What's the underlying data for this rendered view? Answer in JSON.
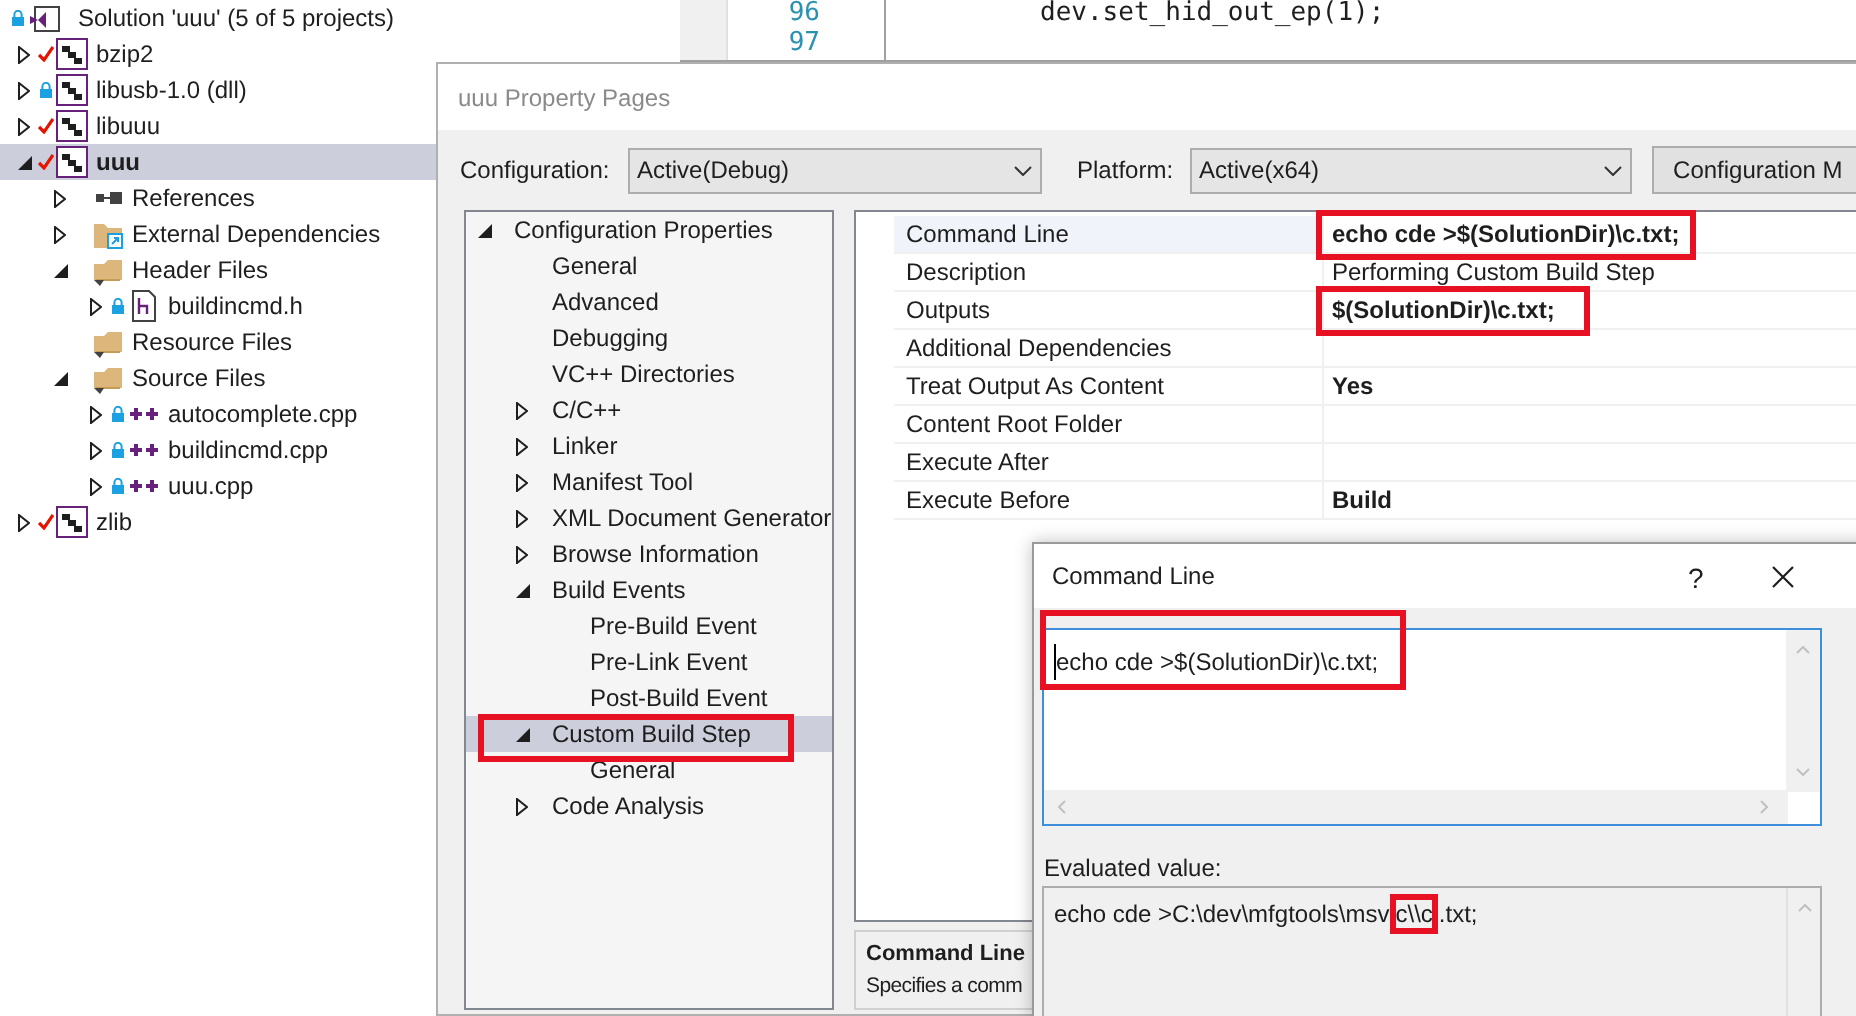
{
  "solution_explorer": {
    "solution": {
      "label": "Solution 'uuu' (5 of 5 projects)",
      "locked": true,
      "checked_out": false
    },
    "items": [
      {
        "label": "bzip2",
        "kind": "project",
        "checked_out": true,
        "locked": false,
        "expanded": false,
        "selected": false
      },
      {
        "label": "libusb-1.0 (dll)",
        "kind": "project",
        "checked_out": false,
        "locked": true,
        "expanded": false,
        "selected": false
      },
      {
        "label": "libuuu",
        "kind": "project",
        "checked_out": true,
        "locked": false,
        "expanded": false,
        "selected": false
      },
      {
        "label": "uuu",
        "kind": "project",
        "checked_out": true,
        "locked": false,
        "expanded": true,
        "selected": true,
        "children": [
          {
            "label": "References",
            "kind": "references",
            "expanded": false,
            "selected": false
          },
          {
            "label": "External Dependencies",
            "kind": "external",
            "expanded": false,
            "selected": false
          },
          {
            "label": "Header Files",
            "kind": "filter",
            "expanded": true,
            "selected": false,
            "children": [
              {
                "label": "buildincmd.h",
                "kind": "header",
                "checked_out": false,
                "locked": true,
                "expanded": false,
                "selected": false
              }
            ]
          },
          {
            "label": "Resource Files",
            "kind": "filter",
            "selected": false
          },
          {
            "label": "Source Files",
            "kind": "filter",
            "expanded": true,
            "selected": false,
            "children": [
              {
                "label": "autocomplete.cpp",
                "kind": "cpp",
                "checked_out": false,
                "locked": true,
                "expanded": false,
                "selected": false
              },
              {
                "label": "buildincmd.cpp",
                "kind": "cpp",
                "checked_out": false,
                "locked": true,
                "expanded": false,
                "selected": false
              },
              {
                "label": "uuu.cpp",
                "kind": "cpp",
                "checked_out": false,
                "locked": true,
                "expanded": false,
                "selected": false
              }
            ]
          }
        ]
      },
      {
        "label": "zlib",
        "kind": "project",
        "checked_out": true,
        "locked": false,
        "expanded": false,
        "selected": false
      }
    ]
  },
  "editor": {
    "lines": [
      {
        "number": "96",
        "code": "dev.set_hid_out_ep(1);"
      },
      {
        "number": "97"
      }
    ]
  },
  "property_pages": {
    "title": "uuu Property Pages",
    "configuration_label": "Configuration:",
    "configuration_value": "Active(Debug)",
    "platform_label": "Platform:",
    "platform_value": "Active(x64)",
    "manager_button": "Configuration M",
    "tree": [
      {
        "label": "Configuration Properties",
        "expanded": true,
        "selected": false,
        "children": [
          {
            "label": "General",
            "selected": false
          },
          {
            "label": "Advanced",
            "selected": false
          },
          {
            "label": "Debugging",
            "selected": false
          },
          {
            "label": "VC++ Directories",
            "selected": false
          },
          {
            "label": "C/C++",
            "expanded": false,
            "selected": false
          },
          {
            "label": "Linker",
            "expanded": false,
            "selected": false
          },
          {
            "label": "Manifest Tool",
            "expanded": false,
            "selected": false
          },
          {
            "label": "XML Document Generator",
            "expanded": false,
            "selected": false
          },
          {
            "label": "Browse Information",
            "expanded": false,
            "selected": false
          },
          {
            "label": "Build Events",
            "expanded": true,
            "selected": false,
            "children": [
              {
                "label": "Pre-Build Event",
                "selected": false
              },
              {
                "label": "Pre-Link Event",
                "selected": false
              },
              {
                "label": "Post-Build Event",
                "selected": false
              }
            ]
          },
          {
            "label": "Custom Build Step",
            "expanded": true,
            "selected": true,
            "annotated": true,
            "children": [
              {
                "label": "General",
                "selected": false
              }
            ]
          },
          {
            "label": "Code Analysis",
            "expanded": false,
            "selected": false
          }
        ]
      }
    ],
    "properties": [
      {
        "name": "Command Line",
        "value": "echo cde >$(SolutionDir)\\c.txt;",
        "bold": true,
        "annotated": true
      },
      {
        "name": "Description",
        "value": "Performing Custom Build Step",
        "bold": false,
        "annotated": false
      },
      {
        "name": "Outputs",
        "value": "$(SolutionDir)\\c.txt;",
        "bold": true,
        "annotated": true
      },
      {
        "name": "Additional Dependencies",
        "annotated": false
      },
      {
        "name": "Treat Output As Content",
        "value": "Yes",
        "bold": true,
        "annotated": false
      },
      {
        "name": "Content Root Folder",
        "annotated": false
      },
      {
        "name": "Execute After",
        "annotated": false
      },
      {
        "name": "Execute Before",
        "value": "Build",
        "bold": true,
        "annotated": false
      }
    ],
    "description": {
      "title": "Command Line",
      "text": "Specifies a comm"
    }
  },
  "command_line_dialog": {
    "title": "Command Line",
    "help": "?",
    "value": "echo cde >$(SolutionDir)\\c.txt;",
    "annotated": true,
    "evaluated_label": "Evaluated value:",
    "evaluated_value": {
      "before": "echo cde >C:\\dev\\mfgtools\\msv",
      "marked": "c\\\\c",
      "after": ".txt;"
    }
  }
}
